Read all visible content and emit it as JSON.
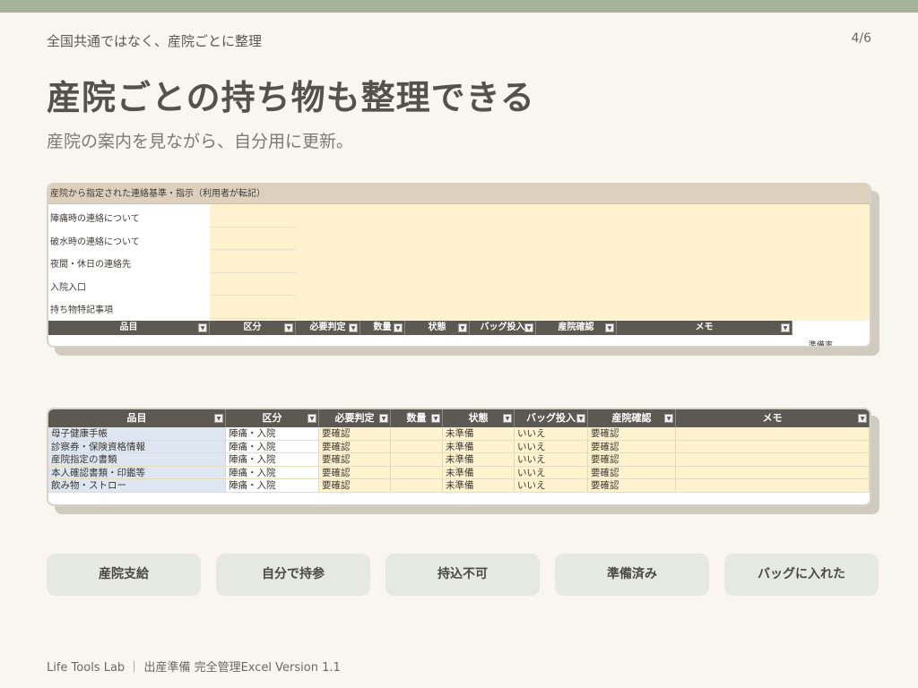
{
  "header": {
    "section_label": "全国共通ではなく、産院ごとに整理",
    "page_number": "4/6",
    "title": "産院ごとの持ち物も整理できる",
    "subtitle": "産院の案内を見ながら、自分用に更新。"
  },
  "sheet1": {
    "section_header": "産院から指定された連絡基準・指示（利用者が転記）",
    "contact_rows": [
      "陣痛時の連絡について",
      "破水時の連絡について",
      "夜間・休日の連絡先",
      "入院入口",
      "持ち物特記事項"
    ],
    "columns": [
      "品目",
      "区分",
      "必要判定",
      "数量",
      "状態",
      "バッグ投入",
      "産院確認",
      "メモ"
    ],
    "readiness_label": "準備率"
  },
  "sheet2": {
    "columns": [
      "品目",
      "区分",
      "必要判定",
      "数量",
      "状態",
      "バッグ投入",
      "産院確認",
      "メモ"
    ],
    "rows": [
      [
        "母子健康手帳",
        "陣痛・入院",
        "要確認",
        "",
        "未準備",
        "いいえ",
        "要確認",
        ""
      ],
      [
        "診察券・保険資格情報",
        "陣痛・入院",
        "要確認",
        "",
        "未準備",
        "いいえ",
        "要確認",
        ""
      ],
      [
        "産院指定の書類",
        "陣痛・入院",
        "要確認",
        "",
        "未準備",
        "いいえ",
        "要確認",
        ""
      ],
      [
        "本人確認書類・印鑑等",
        "陣痛・入院",
        "要確認",
        "",
        "未準備",
        "いいえ",
        "要確認",
        ""
      ],
      [
        "飲み物・ストロー",
        "陣痛・入院",
        "要確認",
        "",
        "未準備",
        "いいえ",
        "要確認",
        ""
      ]
    ]
  },
  "legend": [
    "産院支給",
    "自分で持参",
    "持込不可",
    "準備済み",
    "バッグに入れた"
  ],
  "footer": "Life Tools Lab ｜ 出産準備 完全管理Excel Version 1.1",
  "colors": {
    "topbar": "#a4b19b",
    "table_header": "#5c5852",
    "cell_yellow": "#fff3cf",
    "cell_blue": "#dde6f1",
    "pill": "#e6e9e0"
  }
}
